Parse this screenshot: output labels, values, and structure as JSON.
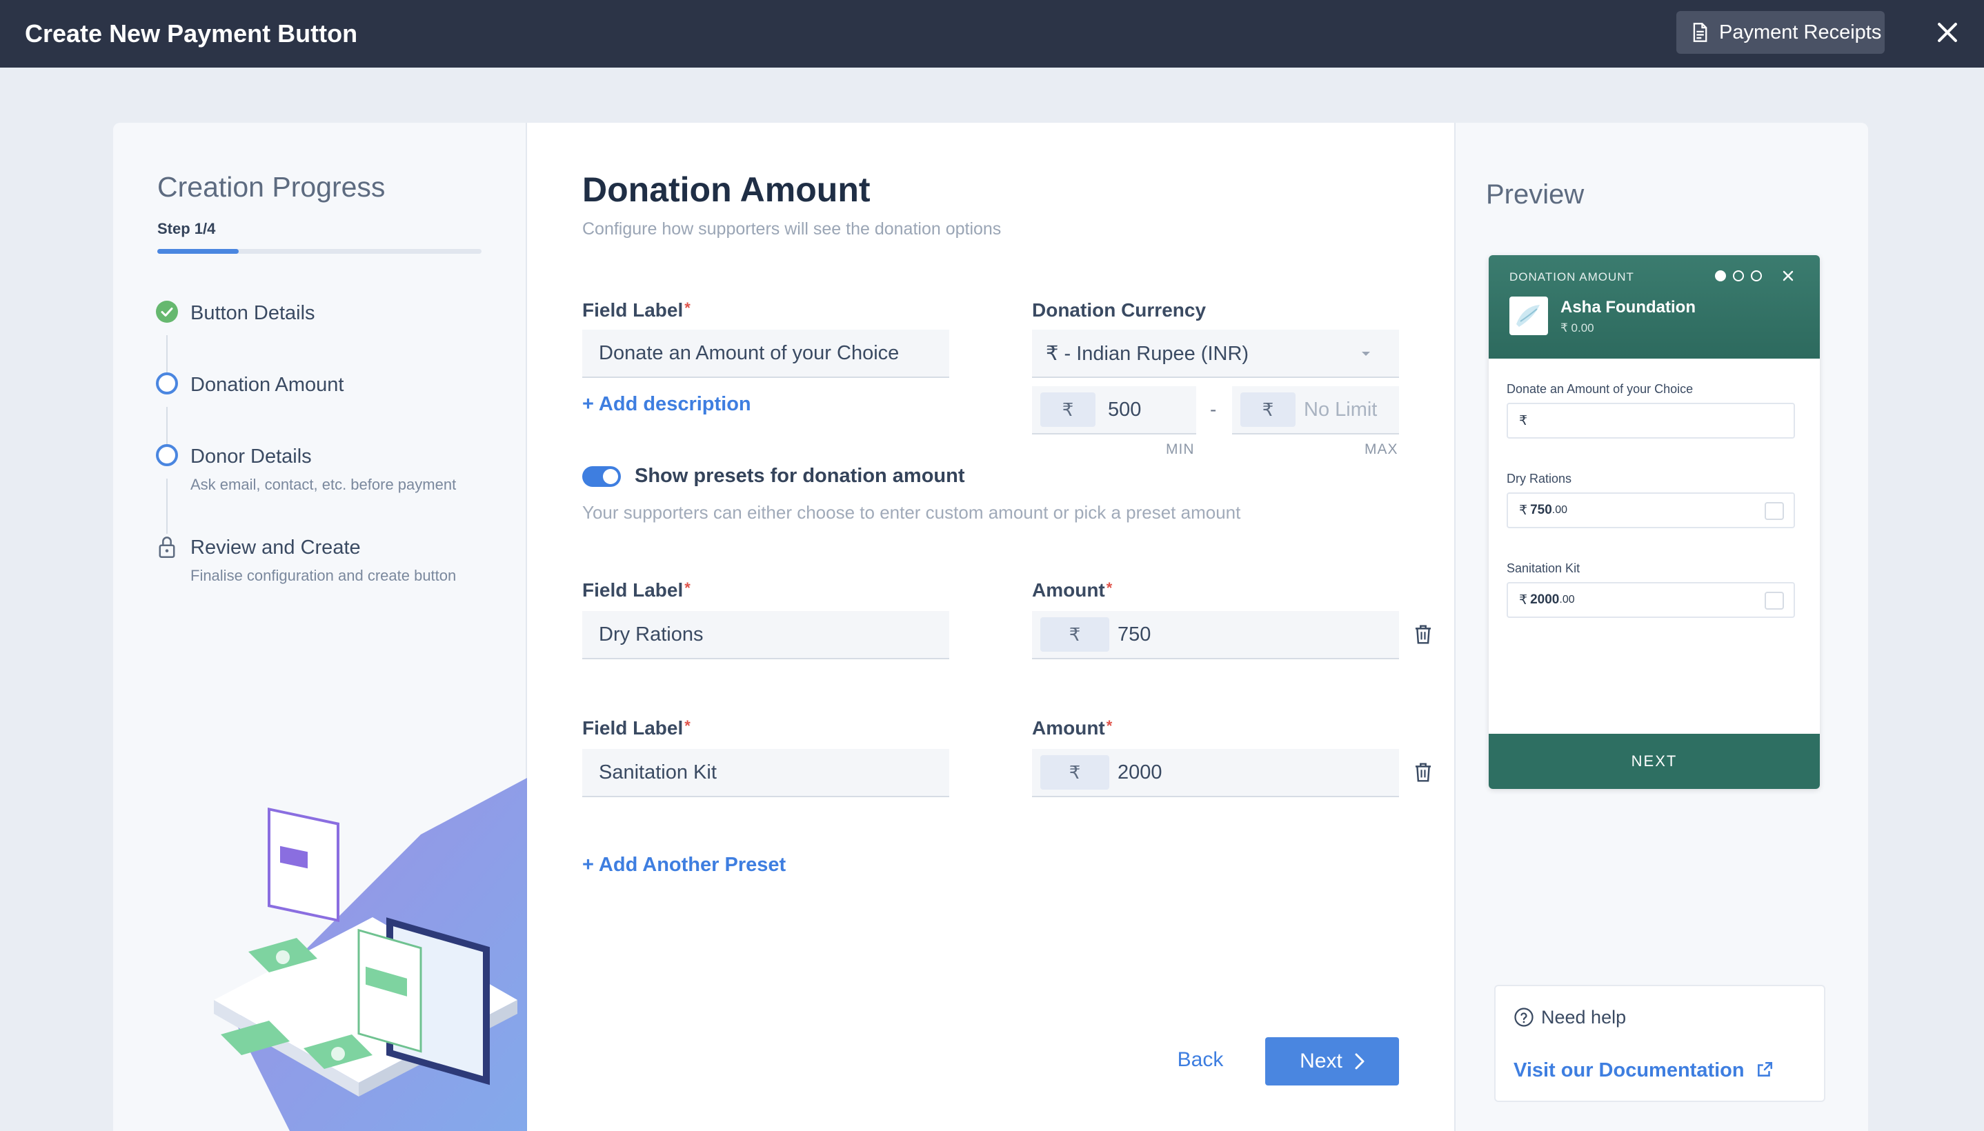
{
  "header": {
    "title": "Create New Payment Button",
    "receipts_label": "Payment Receipts",
    "receipts_icon": "document-icon",
    "close_icon": "close-icon"
  },
  "progress": {
    "title": "Creation Progress",
    "step_text": "Step 1/4",
    "fraction": 0.25,
    "steps": [
      {
        "label": "Button Details",
        "sub": "",
        "state": "done"
      },
      {
        "label": "Donation Amount",
        "sub": "",
        "state": "current"
      },
      {
        "label": "Donor Details",
        "sub": "Ask email, contact, etc. before payment",
        "state": "pending"
      },
      {
        "label": "Review and Create",
        "sub": "Finalise configuration and create button",
        "state": "locked"
      }
    ]
  },
  "main": {
    "title": "Donation Amount",
    "subtitle": "Configure how supporters will see the donation options",
    "field_label": "Field Label",
    "field_value": "Donate an Amount of your Choice",
    "add_description": "+ Add description",
    "currency_label": "Donation Currency",
    "currency_value": "₹ - Indian Rupee (INR)",
    "currency_symbol": "₹",
    "min_value": "500",
    "max_placeholder": "No Limit",
    "min_caption": "MIN",
    "max_caption": "MAX",
    "range_separator": "-",
    "toggle_label": "Show presets for donation amount",
    "toggle_on": true,
    "toggle_help": "Your supporters can either choose to enter custom amount or pick a preset amount",
    "amount_label": "Amount",
    "presets": [
      {
        "label": "Dry Rations",
        "amount": "750"
      },
      {
        "label": "Sanitation Kit",
        "amount": "2000"
      }
    ],
    "add_preset": "+ Add Another Preset",
    "back_label": "Back",
    "next_label": "Next"
  },
  "preview": {
    "title": "Preview",
    "kicker": "DONATION AMOUNT",
    "org_name": "Asha Foundation",
    "org_amount": "₹ 0.00",
    "custom_label": "Donate an Amount of your Choice",
    "custom_symbol": "₹",
    "items": [
      {
        "label": "Dry Rations",
        "symbol": "₹",
        "whole": "750",
        "cents": ".00"
      },
      {
        "label": "Sanitation Kit",
        "symbol": "₹",
        "whole": "2000",
        "cents": ".00"
      }
    ],
    "next_label": "NEXT",
    "brand_color": "#2e6f62"
  },
  "help": {
    "title": "Need help",
    "link": "Visit our Documentation"
  },
  "colors": {
    "accent": "#4a86e0",
    "header_bg": "#2c3447",
    "done": "#66b86f",
    "required": "#e0534a"
  }
}
